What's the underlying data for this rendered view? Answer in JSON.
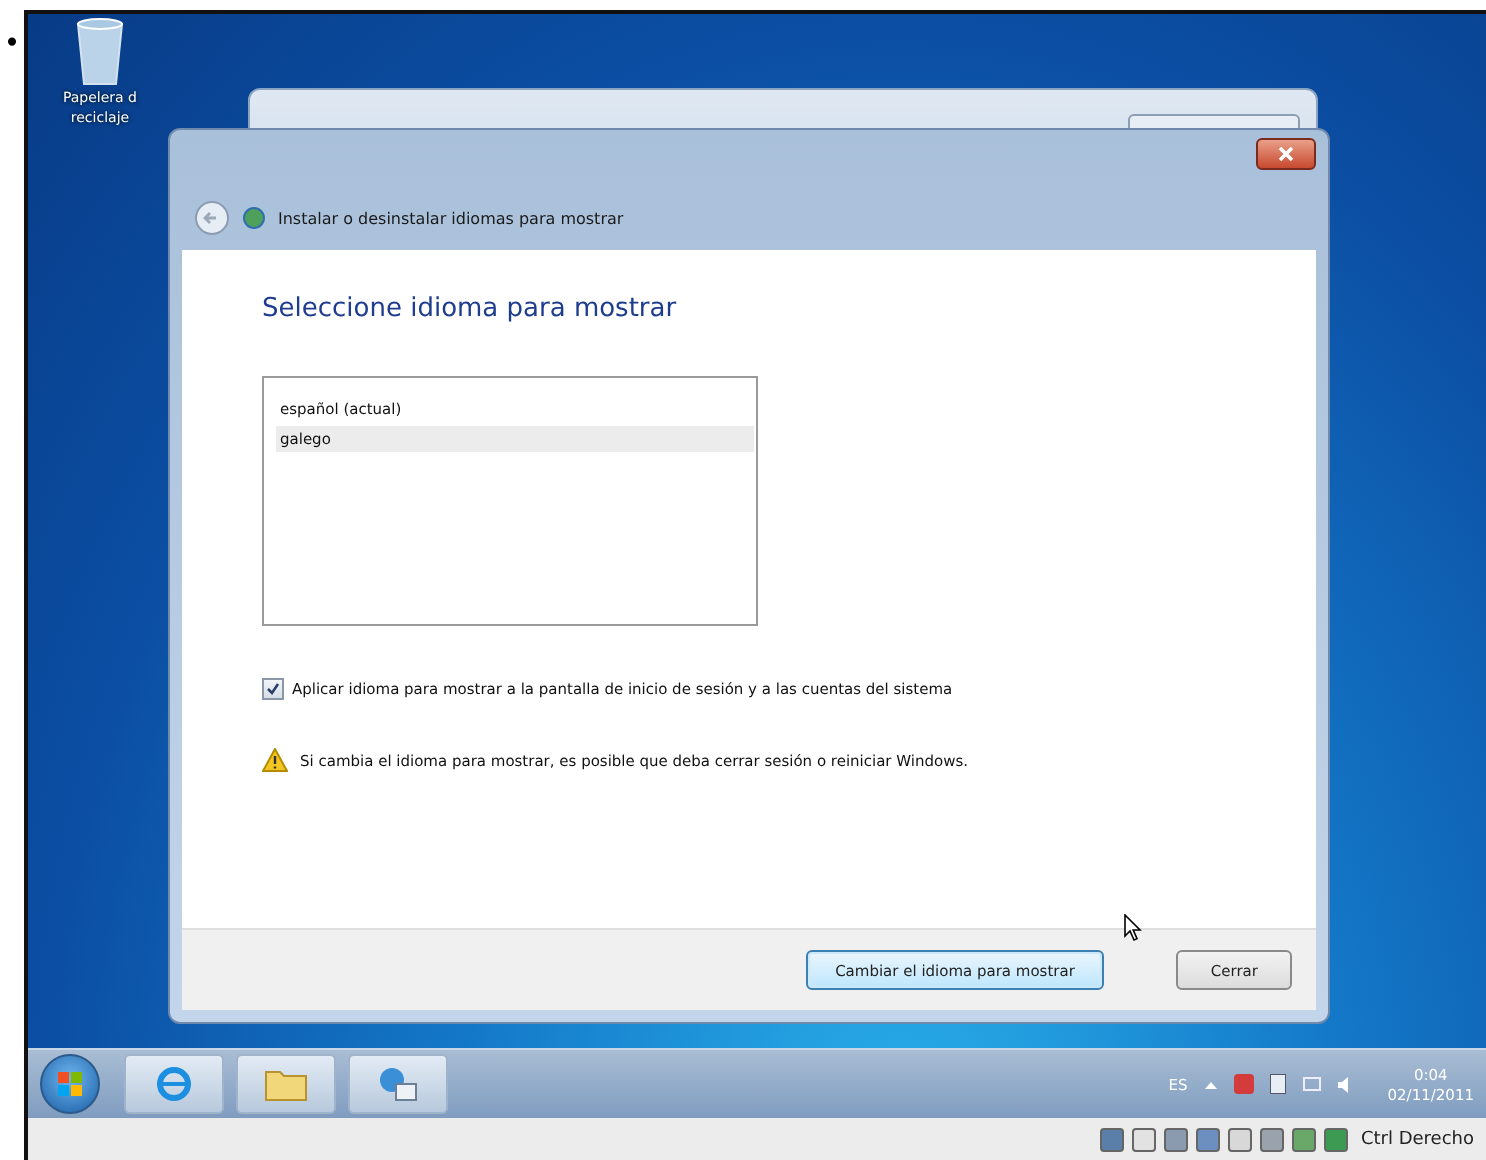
{
  "page": {
    "bullet": "•"
  },
  "desktop": {
    "icons": [
      {
        "label_lines": [
          "Papelera d",
          "reciclaje"
        ]
      }
    ]
  },
  "dialog": {
    "breadcrumb": "Instalar o desinstalar idiomas para mostrar",
    "heading": "Seleccione idioma para mostrar",
    "languages": [
      {
        "label": "español (actual)",
        "selected": false
      },
      {
        "label": "galego",
        "selected": true
      }
    ],
    "apply_checkbox": {
      "label": "Aplicar idioma para mostrar a la pantalla de inicio de sesión y a las cuentas del sistema",
      "checked": true
    },
    "warning": "Si cambia el idioma para mostrar, es posible que deba cerrar sesión o reiniciar Windows.",
    "buttons": [
      {
        "label": "Cambiar el idioma para mostrar",
        "kind": "primary"
      },
      {
        "label": "Cerrar",
        "kind": "default"
      }
    ]
  },
  "taskbar": {
    "language": "ES",
    "clock": {
      "time": "0:04",
      "date": "02/11/2011"
    }
  },
  "vm_status_bar": {
    "host_key": "Ctrl Derecho"
  }
}
